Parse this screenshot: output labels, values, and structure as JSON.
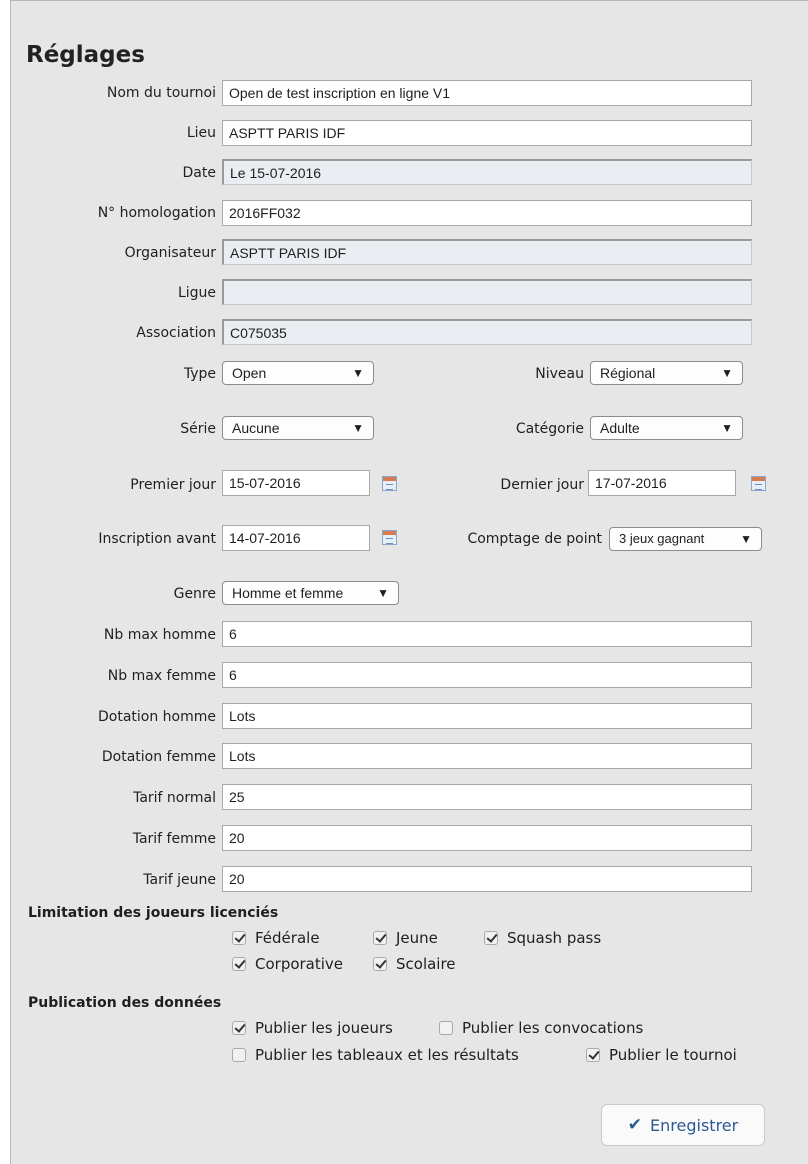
{
  "title": "Réglages",
  "fields": {
    "nom_tournoi": {
      "label": "Nom du tournoi",
      "value": "Open de test inscription en ligne V1"
    },
    "lieu": {
      "label": "Lieu",
      "value": "ASPTT PARIS IDF"
    },
    "date": {
      "label": "Date",
      "value": "Le 15-07-2016"
    },
    "homologation": {
      "label": "N° homologation",
      "value": "2016FF032"
    },
    "organisateur": {
      "label": "Organisateur",
      "value": "ASPTT PARIS IDF"
    },
    "ligue": {
      "label": "Ligue",
      "value": ""
    },
    "association": {
      "label": "Association",
      "value": "C075035"
    },
    "nb_max_homme": {
      "label": "Nb max homme",
      "value": "6"
    },
    "nb_max_femme": {
      "label": "Nb max femme",
      "value": "6"
    },
    "dotation_homme": {
      "label": "Dotation homme",
      "value": "Lots"
    },
    "dotation_femme": {
      "label": "Dotation femme",
      "value": "Lots"
    },
    "tarif_normal": {
      "label": "Tarif normal",
      "value": "25"
    },
    "tarif_femme": {
      "label": "Tarif femme",
      "value": "20"
    },
    "tarif_jeune": {
      "label": "Tarif jeune",
      "value": "20"
    }
  },
  "selects": {
    "type": {
      "label": "Type",
      "value": "Open"
    },
    "niveau": {
      "label": "Niveau",
      "value": "Régional"
    },
    "serie": {
      "label": "Série",
      "value": "Aucune"
    },
    "categorie": {
      "label": "Catégorie",
      "value": "Adulte"
    },
    "comptage": {
      "label": "Comptage de point",
      "value": "3 jeux gagnant"
    },
    "genre": {
      "label": "Genre",
      "value": "Homme et femme"
    }
  },
  "dates": {
    "premier_jour": {
      "label": "Premier jour",
      "value": "15-07-2016"
    },
    "dernier_jour": {
      "label": "Dernier jour",
      "value": "17-07-2016"
    },
    "inscription_avant": {
      "label": "Inscription avant",
      "value": "14-07-2016"
    }
  },
  "limitation": {
    "title": "Limitation des joueurs licenciés",
    "items": [
      {
        "label": "Fédérale",
        "checked": true
      },
      {
        "label": "Jeune",
        "checked": true
      },
      {
        "label": "Squash pass",
        "checked": true
      },
      {
        "label": "Corporative",
        "checked": true
      },
      {
        "label": "Scolaire",
        "checked": true
      }
    ]
  },
  "publication": {
    "title": "Publication des données",
    "items": [
      {
        "label": "Publier les joueurs",
        "checked": true
      },
      {
        "label": "Publier les convocations",
        "checked": false
      },
      {
        "label": "Publier les tableaux et les résultats",
        "checked": false
      },
      {
        "label": "Publier le tournoi",
        "checked": true
      }
    ]
  },
  "save_label": "Enregistrer",
  "icons": {
    "save": "check-icon",
    "calendar": "calendar-icon"
  }
}
